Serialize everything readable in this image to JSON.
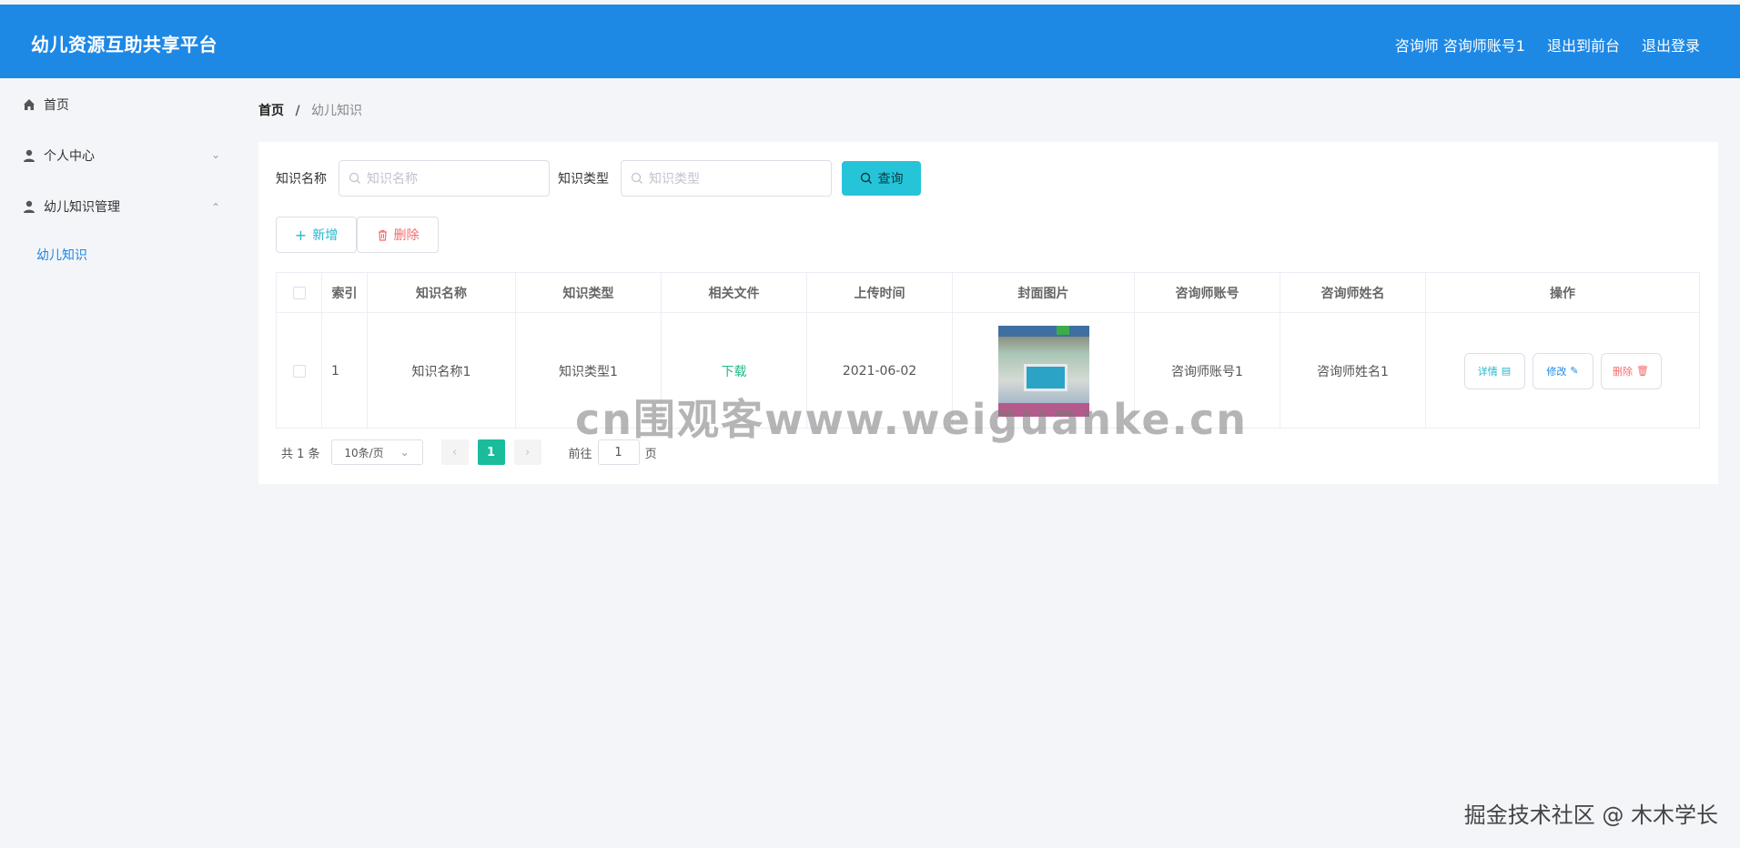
{
  "header": {
    "brand": "幼儿资源互助共享平台",
    "user": "咨询师 咨询师账号1",
    "to_front": "退出到前台",
    "logout": "退出登录"
  },
  "sidebar": {
    "items": [
      {
        "label": "首页",
        "icon": "home-icon"
      },
      {
        "label": "个人中心",
        "icon": "user-icon",
        "chevron": "down"
      },
      {
        "label": "幼儿知识管理",
        "icon": "user-icon",
        "chevron": "up"
      }
    ],
    "sub_items": [
      {
        "label": "幼儿知识"
      }
    ]
  },
  "breadcrumb": {
    "home": "首页",
    "separator": "/",
    "current": "幼儿知识"
  },
  "search": {
    "name_label": "知识名称",
    "name_placeholder": "知识名称",
    "type_label": "知识类型",
    "type_placeholder": "知识类型",
    "query_button": "查询"
  },
  "actions": {
    "add": "新增",
    "delete": "删除"
  },
  "table": {
    "columns": [
      "索引",
      "知识名称",
      "知识类型",
      "相关文件",
      "上传时间",
      "封面图片",
      "咨询师账号",
      "咨询师姓名",
      "操作"
    ],
    "rows": [
      {
        "index": "1",
        "name": "知识名称1",
        "type": "知识类型1",
        "file": "下载",
        "upload_time": "2021-06-02",
        "cover": "",
        "consultant_account": "咨询师账号1",
        "consultant_name": "咨询师姓名1",
        "ops": {
          "detail": "详情",
          "edit": "修改",
          "delete": "删除"
        }
      }
    ]
  },
  "pagination": {
    "total": "共 1 条",
    "page_size": "10条/页",
    "current_page": "1",
    "goto_label": "前往",
    "goto_value": "1",
    "page_suffix": "页"
  },
  "watermarks": {
    "center": "cn围观客www.weiguanke.cn",
    "corner": "掘金技术社区 @ 木木学长"
  },
  "colors": {
    "header_bg": "#1e88e5",
    "accent_query": "#26c4d8",
    "page_active": "#1abc9c",
    "download_link": "#21ba8a"
  }
}
